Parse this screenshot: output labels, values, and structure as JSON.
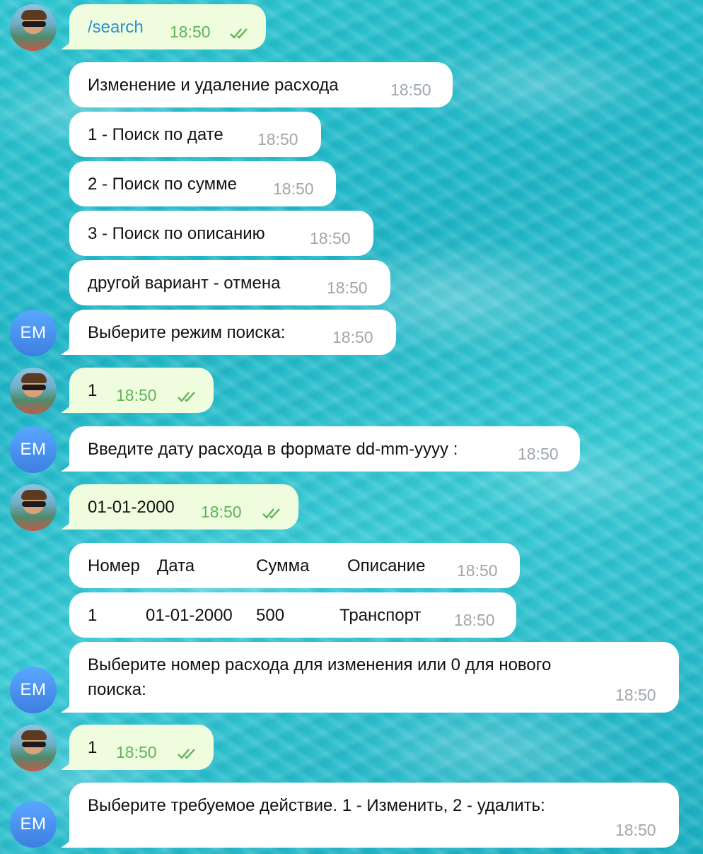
{
  "messages": [
    {
      "text": "/search",
      "time": "18:50"
    },
    {
      "text": "Изменение и удаление расхода",
      "time": "18:50"
    },
    {
      "text": "1 - Поиск по дате",
      "time": "18:50"
    },
    {
      "text": "2 - Поиск по сумме",
      "time": "18:50"
    },
    {
      "text": "3 - Поиск по описанию",
      "time": "18:50"
    },
    {
      "text": "другой вариант - отмена",
      "time": "18:50"
    },
    {
      "text": "Выберите режим поиска:",
      "time": "18:50"
    },
    {
      "text": "1",
      "time": "18:50"
    },
    {
      "text": "Введите дату расхода в формате dd-mm-yyyy :",
      "time": "18:50"
    },
    {
      "text": "01-01-2000",
      "time": "18:50"
    },
    {
      "cells": [
        "Номер",
        "Дата",
        "Сумма",
        "Описание"
      ],
      "time": "18:50"
    },
    {
      "cells": [
        "1",
        "01-01-2000",
        "500",
        "Транспорт"
      ],
      "time": "18:50"
    },
    {
      "text_line1": "Выберите номер расхода для изменения или 0 для нового",
      "text_line2": "поиска:",
      "time": "18:50"
    },
    {
      "text": "1",
      "time": "18:50"
    },
    {
      "text": "Выберите требуемое действие. 1 - Изменить, 2 - удалить:",
      "time": "18:50"
    }
  ],
  "avatars": {
    "user": "user-photo",
    "bot_initials": "EM"
  },
  "colors": {
    "outgoing_bubble": "#effdde",
    "incoming_bubble": "#ffffff",
    "read_check": "#5fb35a",
    "bot_avatar": "#4a90e8",
    "link": "#2a8fd4"
  },
  "icons": {
    "read_status": "double-check-icon"
  }
}
